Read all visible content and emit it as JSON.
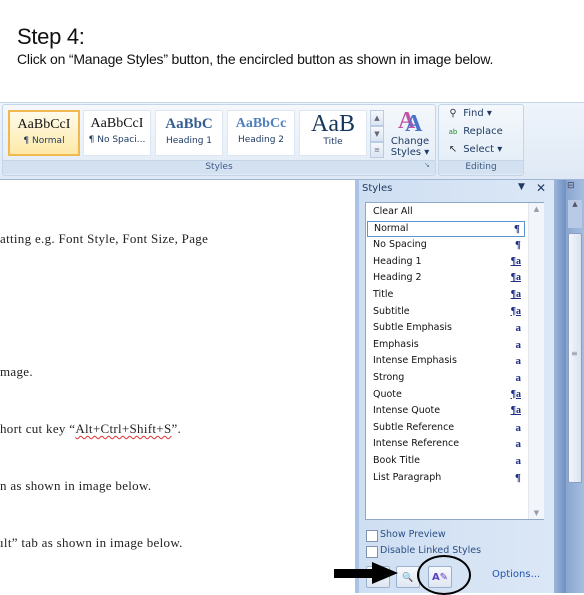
{
  "instruction": {
    "step_title": "Step 4:",
    "description": "Click on “Manage Styles” button, the encircled button as shown in image below."
  },
  "ribbon": {
    "styles_group": {
      "label": "Styles",
      "tiles": [
        {
          "sample": "AaBbCcI",
          "label": "¶ Normal",
          "selected": true
        },
        {
          "sample": "AaBbCcI",
          "label": "¶ No Spaci...",
          "selected": false
        },
        {
          "sample": "AaBbC",
          "label": "Heading 1",
          "selected": false
        },
        {
          "sample": "AaBbCc",
          "label": "Heading 2",
          "selected": false
        },
        {
          "sample": "AaB",
          "label": "Title",
          "selected": false
        }
      ],
      "scroll_up": "▲",
      "scroll_down": "▼",
      "more": "≡",
      "change_styles": {
        "icon": "change-styles-icon",
        "line1": "Change",
        "line2": "Styles ▾"
      },
      "launcher": "↘"
    },
    "editing_group": {
      "label": "Editing",
      "items": [
        {
          "icon": "binoculars-icon",
          "glyph": "🔭",
          "label": "Find ▾"
        },
        {
          "icon": "replace-icon",
          "glyph": "ab",
          "label": "Replace"
        },
        {
          "icon": "cursor-icon",
          "glyph": "↖",
          "label": "Select ▾"
        }
      ]
    }
  },
  "document": {
    "lines": [
      "atting e.g.  Font Style, Font Size, Page",
      "mage.",
      "hort cut key  “",
      "Alt+Ctrl+Shift+S",
      "”.",
      "n as shown in image below.",
      "ılt” tab as shown in image below."
    ]
  },
  "styles_pane": {
    "title": "Styles",
    "menu_glyph": "▼",
    "close_glyph": "✕",
    "items": [
      {
        "name": "Clear All",
        "glyph": "",
        "type": "none"
      },
      {
        "name": "Normal",
        "glyph": "¶",
        "type": "paragraph",
        "selected": true
      },
      {
        "name": "No Spacing",
        "glyph": "¶",
        "type": "paragraph"
      },
      {
        "name": "Heading 1",
        "glyph": "¶a",
        "type": "linked"
      },
      {
        "name": "Heading 2",
        "glyph": "¶a",
        "type": "linked"
      },
      {
        "name": "Title",
        "glyph": "¶a",
        "type": "linked"
      },
      {
        "name": "Subtitle",
        "glyph": "¶a",
        "type": "linked"
      },
      {
        "name": "Subtle Emphasis",
        "glyph": "a",
        "type": "character"
      },
      {
        "name": "Emphasis",
        "glyph": "a",
        "type": "character"
      },
      {
        "name": "Intense Emphasis",
        "glyph": "a",
        "type": "character"
      },
      {
        "name": "Strong",
        "glyph": "a",
        "type": "character"
      },
      {
        "name": "Quote",
        "glyph": "¶a",
        "type": "linked"
      },
      {
        "name": "Intense Quote",
        "glyph": "¶a",
        "type": "linked"
      },
      {
        "name": "Subtle Reference",
        "glyph": "a",
        "type": "character"
      },
      {
        "name": "Intense Reference",
        "glyph": "a",
        "type": "character"
      },
      {
        "name": "Book Title",
        "glyph": "a",
        "type": "character"
      },
      {
        "name": "List Paragraph",
        "glyph": "¶",
        "type": "paragraph"
      }
    ],
    "show_preview": {
      "label": "Show Preview",
      "checked": false
    },
    "disable_linked": {
      "label": "Disable Linked Styles",
      "checked": false
    },
    "buttons": [
      {
        "name": "new-style",
        "glyph": "✦"
      },
      {
        "name": "style-inspector",
        "glyph": "🔍"
      },
      {
        "name": "manage-styles",
        "glyph": "A✎"
      }
    ],
    "options_label": "Options..."
  },
  "scrollbar": {
    "split_glyph": "⊟",
    "up_glyph": "▲",
    "grip_glyph": "≡"
  },
  "colors": {
    "accent": "#1f3b64",
    "selected_tile": "#f0b84e",
    "link": "#2354b0",
    "pane_bg": "#d5e3f4"
  }
}
